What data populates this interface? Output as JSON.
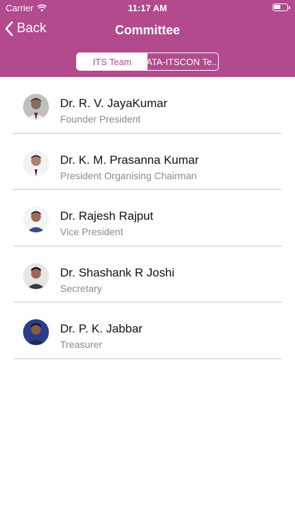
{
  "status_bar": {
    "carrier": "Carrier",
    "time": "11:17 AM"
  },
  "nav": {
    "back_label": "Back",
    "title": "Committee"
  },
  "segments": [
    {
      "label": "ITS Team",
      "selected": true
    },
    {
      "label": "ATA-ITSCON Te...",
      "selected": false
    }
  ],
  "members": [
    {
      "name": "Dr. R. V. JayaKumar",
      "role": "Founder President"
    },
    {
      "name": "Dr. K. M. Prasanna Kumar",
      "role": "President Organising Chairman"
    },
    {
      "name": "Dr. Rajesh Rajput",
      "role": "Vice President"
    },
    {
      "name": "Dr. Shashank R Joshi",
      "role": "Secretary"
    },
    {
      "name": "Dr. P. K. Jabbar",
      "role": "Treasurer"
    }
  ],
  "colors": {
    "brand": "#b24a8d",
    "separator": "#c8c8cc",
    "subtitle": "#8a8a8f"
  }
}
